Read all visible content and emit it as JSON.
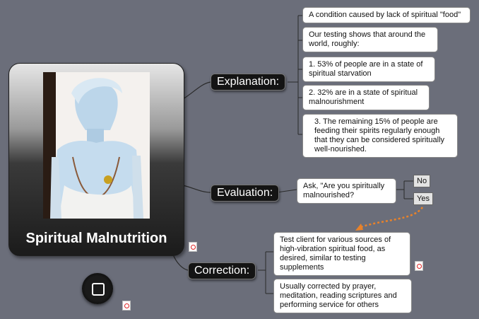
{
  "central": {
    "title": "Spiritual Malnutrition"
  },
  "branches": {
    "explanation": {
      "label": "Explanation:",
      "topics": [
        {
          "lines": [
            "A condition caused by lack of spiritual \"food\""
          ]
        },
        {
          "lines": [
            "Our testing shows that around the",
            "world, roughly:"
          ]
        },
        {
          "lines": [
            "1. 53% of people are in a state of",
            "spiritual starvation"
          ]
        },
        {
          "lines": [
            "2. 32% are in a state of spiritual",
            "malnourishment"
          ]
        },
        {
          "lines": [
            "3. The remaining 15% of people are",
            "feeding their spirits regularly enough",
            "that they can be considered spiritually",
            "well-nourished."
          ]
        }
      ]
    },
    "evaluation": {
      "label": "Evaluation:",
      "topic": {
        "lines": [
          "Ask, \"Are you spiritually",
          "malnourished?"
        ]
      },
      "options": [
        "No",
        "Yes"
      ]
    },
    "correction": {
      "label": "Correction:",
      "topics": [
        {
          "lines": [
            "Test client for various sources of",
            "high-vibration spiritual food, as",
            "desired, similar to testing",
            "supplements"
          ]
        },
        {
          "lines": [
            "Usually corrected by prayer,",
            "meditation, reading scriptures and",
            "performing service for others"
          ]
        }
      ]
    }
  },
  "colors": {
    "background": "#6b6e7a",
    "branch_fill": "#141414",
    "topic_fill": "#ffffff",
    "relationship_arrow": "#e8822a"
  },
  "icons": [
    "photo",
    "pdf-attachment-icon",
    "chat-bubble-icon"
  ]
}
